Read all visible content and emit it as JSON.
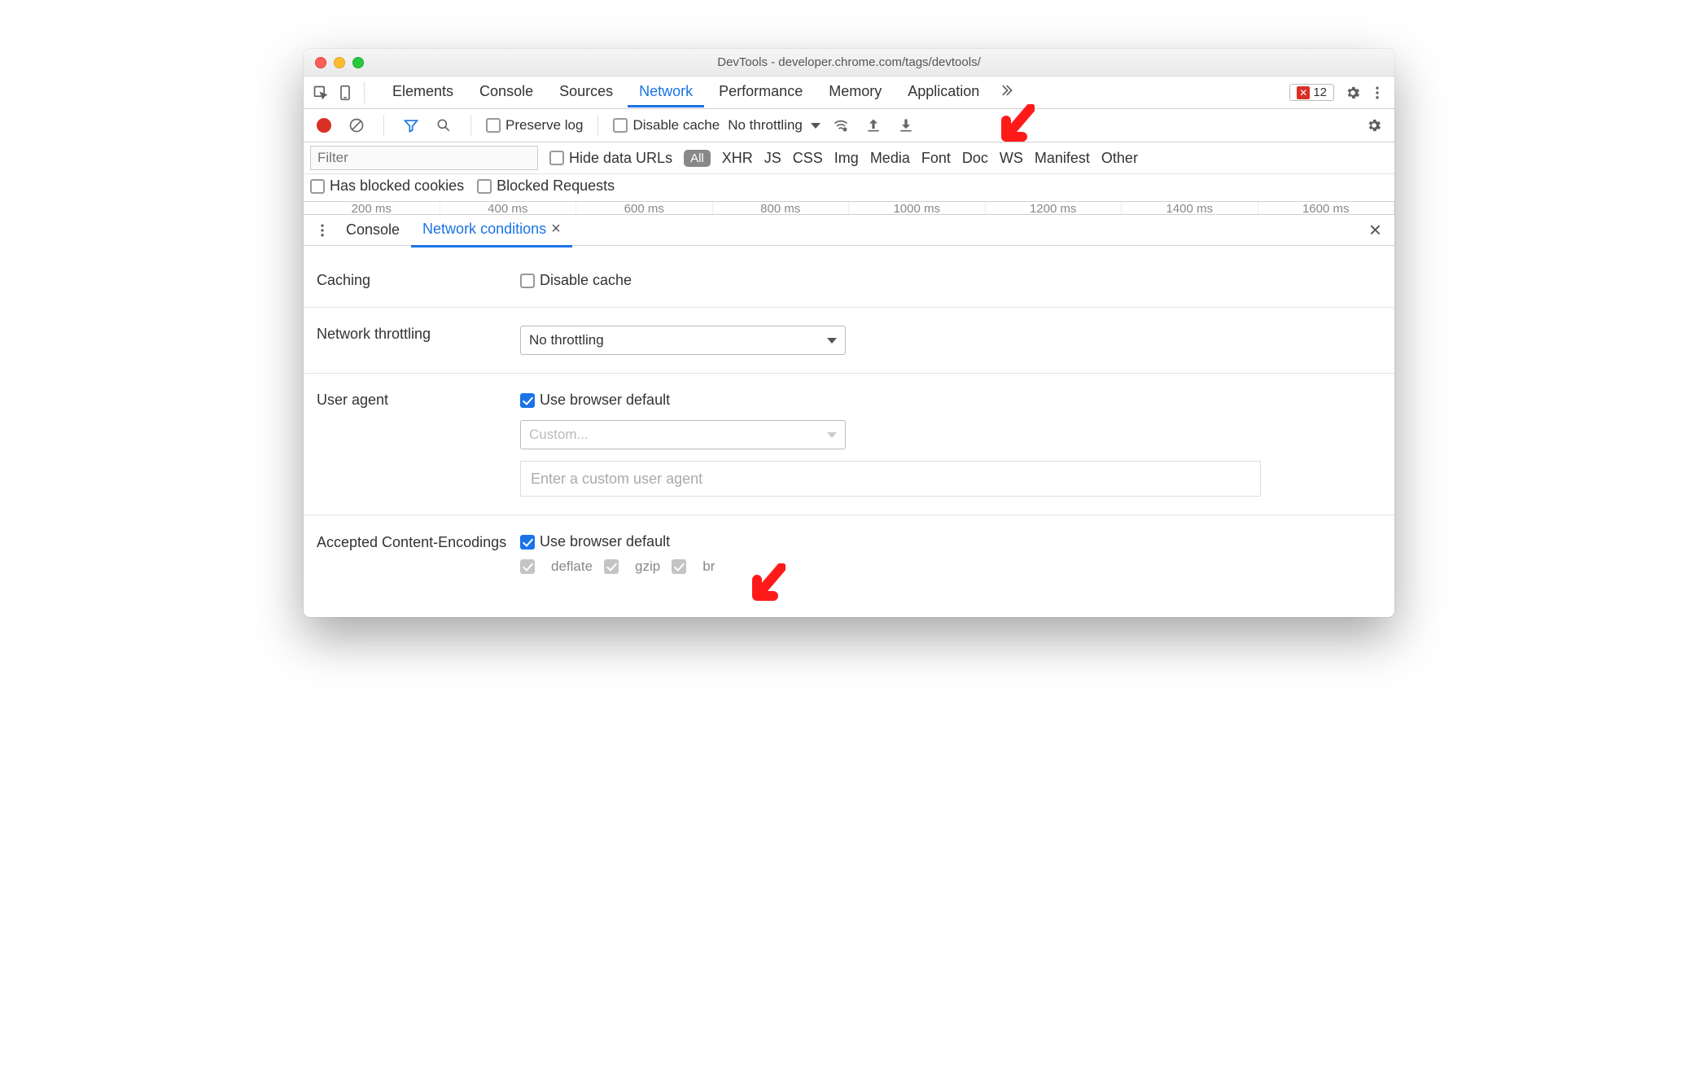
{
  "window": {
    "title": "DevTools - developer.chrome.com/tags/devtools/"
  },
  "tabs": {
    "items": [
      "Elements",
      "Console",
      "Sources",
      "Network",
      "Performance",
      "Memory",
      "Application"
    ],
    "active": "Network",
    "error_count": "12"
  },
  "net_toolbar": {
    "preserve_log": "Preserve log",
    "disable_cache": "Disable cache",
    "throttling": "No throttling"
  },
  "filter": {
    "placeholder": "Filter",
    "hide_data_urls": "Hide data URLs",
    "types": [
      "All",
      "XHR",
      "JS",
      "CSS",
      "Img",
      "Media",
      "Font",
      "Doc",
      "WS",
      "Manifest",
      "Other"
    ],
    "has_blocked_cookies": "Has blocked cookies",
    "blocked_requests": "Blocked Requests"
  },
  "timeline": [
    "200 ms",
    "400 ms",
    "600 ms",
    "800 ms",
    "1000 ms",
    "1200 ms",
    "1400 ms",
    "1600 ms"
  ],
  "drawer": {
    "console": "Console",
    "network_conditions": "Network conditions"
  },
  "conditions": {
    "caching_label": "Caching",
    "caching_disable": "Disable cache",
    "throttling_label": "Network throttling",
    "throttling_value": "No throttling",
    "ua_label": "User agent",
    "ua_default": "Use browser default",
    "ua_custom_placeholder": "Custom...",
    "ua_textarea_placeholder": "Enter a custom user agent",
    "enc_label": "Accepted Content-Encodings",
    "enc_default": "Use browser default",
    "enc_options": [
      "deflate",
      "gzip",
      "br"
    ]
  }
}
